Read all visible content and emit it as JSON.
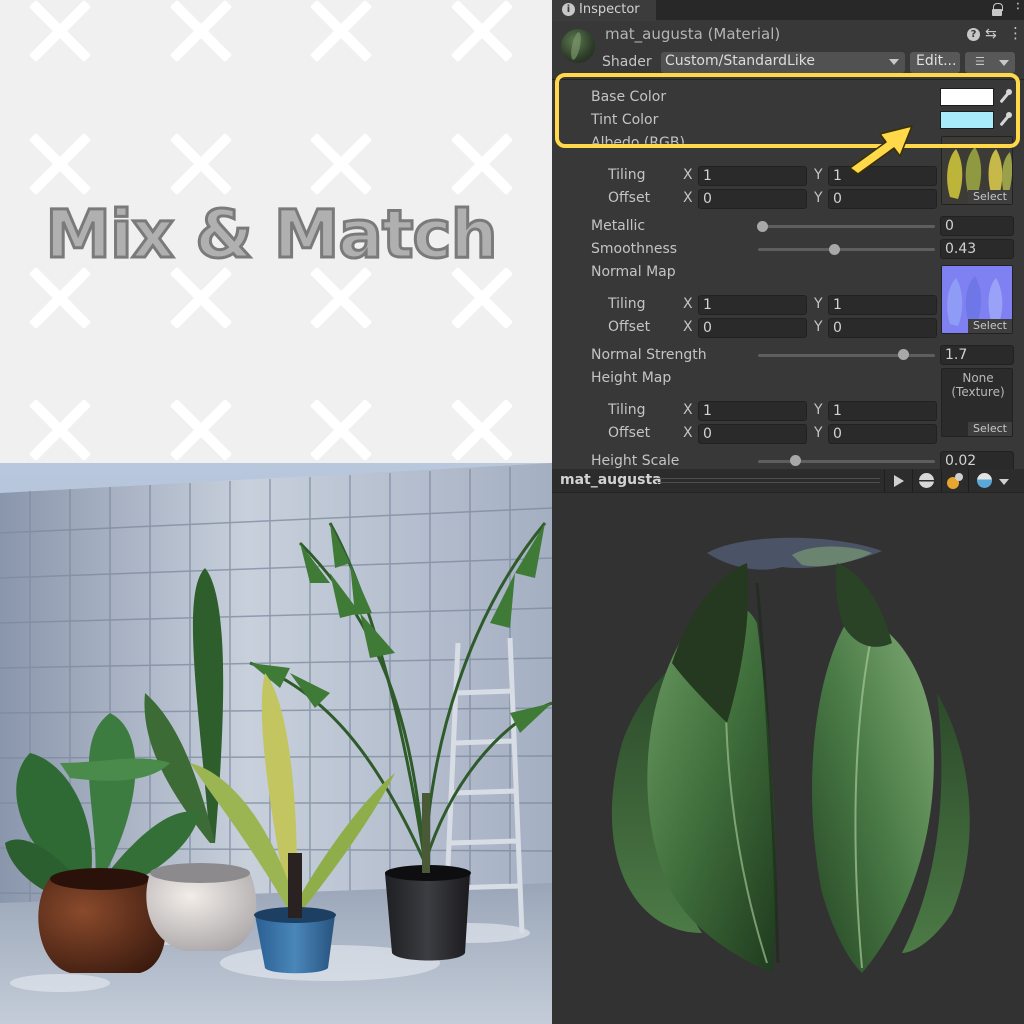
{
  "banner": {
    "title": "Mix & Match"
  },
  "inspector": {
    "tab_label": "Inspector",
    "material_title": "mat_augusta (Material)",
    "shader_label": "Shader",
    "shader_value": "Custom/StandardLike",
    "edit_label": "Edit...",
    "properties": {
      "base_color_label": "Base Color",
      "base_color_value": "#ffffff",
      "tint_color_label": "Tint Color",
      "tint_color_value": "#a8ecfb",
      "albedo_label": "Albedo (RGB)",
      "albedo_tiling_label": "Tiling",
      "albedo_tiling_x": "1",
      "albedo_tiling_y": "1",
      "albedo_offset_label": "Offset",
      "albedo_offset_x": "0",
      "albedo_offset_y": "0",
      "metallic_label": "Metallic",
      "metallic_value": "0",
      "smoothness_label": "Smoothness",
      "smoothness_value": "0.43",
      "normal_map_label": "Normal Map",
      "normal_tiling_label": "Tiling",
      "normal_tiling_x": "1",
      "normal_tiling_y": "1",
      "normal_offset_label": "Offset",
      "normal_offset_x": "0",
      "normal_offset_y": "0",
      "normal_strength_label": "Normal Strength",
      "normal_strength_value": "1.7",
      "height_map_label": "Height Map",
      "height_map_slot_text": "None\n(Texture)",
      "height_tiling_label": "Tiling",
      "height_tiling_x": "1",
      "height_tiling_y": "1",
      "height_offset_label": "Offset",
      "height_offset_x": "0",
      "height_offset_y": "0",
      "height_scale_label": "Height Scale",
      "height_scale_value": "0.02",
      "select_label": "Select",
      "x_axis": "X",
      "y_axis": "Y"
    }
  },
  "preview": {
    "name": "mat_augusta"
  },
  "colors": {
    "highlight": "#ffd94a",
    "accent_arrow": "#ffd94a"
  }
}
